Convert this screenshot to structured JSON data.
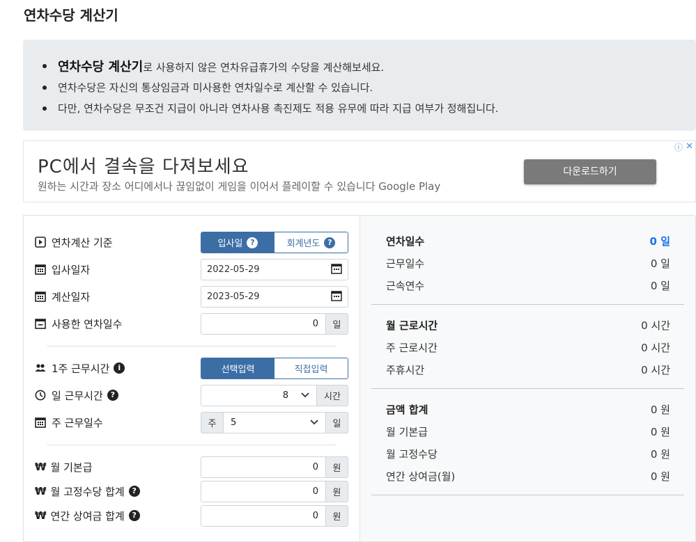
{
  "page": {
    "title": "연차수당 계산기"
  },
  "info": {
    "item1_strong": "연차수당 계산기",
    "item1_rest": "로 사용하지 않은 연차유급휴가의 수당을 계산해보세요.",
    "item2": "연차수당은 자신의 통상임금과 미사용한 연차일수로 계산할 수 있습니다.",
    "item3": "다만, 연차수당은 무조건 지급이 아니라 연차사용 촉진제도 적용 유무에 따라 지급 여부가 정해집니다."
  },
  "ad": {
    "title": "PC에서 결속을 다져보세요",
    "subtitle": "원하는 시간과 장소 어디에서나 끊임없이 게임을 이어서 플레이할 수 있습니다 Google Play",
    "button": "다운로드하기",
    "info_icon": "ⓘ",
    "close_icon": "✕"
  },
  "form": {
    "basis": {
      "label": "연차계산 기준",
      "opt1": "입사일",
      "opt2": "회계년도",
      "q": "?"
    },
    "join_date": {
      "label": "입사일자",
      "value": "2022-05-29"
    },
    "calc_date": {
      "label": "계산일자",
      "value": "2023-05-29"
    },
    "used_days": {
      "label": "사용한 연차일수",
      "value": "0",
      "unit": "일"
    },
    "weekly_hours": {
      "label": "1주 근무시간",
      "info": "i",
      "opt1": "선택입력",
      "opt2": "직접입력"
    },
    "daily_hours": {
      "label": "일 근무시간",
      "q": "?",
      "value": "8",
      "unit": "시간"
    },
    "weekly_days": {
      "label": "주 근무일수",
      "prefix": "주",
      "value": "5",
      "unit": "일"
    },
    "monthly_salary": {
      "label": "월 기본급",
      "currency": "₩",
      "value": "0",
      "unit": "원"
    },
    "fixed_allowance": {
      "label": "월 고정수당 합계",
      "currency": "₩",
      "q": "?",
      "value": "0",
      "unit": "원"
    },
    "annual_bonus": {
      "label": "연간 상여금 합계",
      "currency": "₩",
      "q": "?",
      "value": "0",
      "unit": "원"
    }
  },
  "result": {
    "leave_days": {
      "label": "연차일수",
      "value": "0 일"
    },
    "work_days": {
      "label": "근무일수",
      "value": "0 일"
    },
    "service_years": {
      "label": "근속연수",
      "value": "0 일"
    },
    "monthly_hours": {
      "label": "월 근로시간",
      "value": "0 시간"
    },
    "weekly_hours": {
      "label": "주 근로시간",
      "value": "0 시간"
    },
    "weekly_rest": {
      "label": "주휴시간",
      "value": "0 시간"
    },
    "total": {
      "label": "금액 합계",
      "value": "0 원"
    },
    "base_pay": {
      "label": "월 기본급",
      "value": "0 원"
    },
    "fixed_pay": {
      "label": "월 고정수당",
      "value": "0 원"
    },
    "bonus": {
      "label": "연간 상여금(월)",
      "value": "0 원"
    }
  },
  "colors": {
    "primary": "#3b6ea5",
    "accent": "#1a73e8",
    "ad_button": "#7a7a7a"
  }
}
